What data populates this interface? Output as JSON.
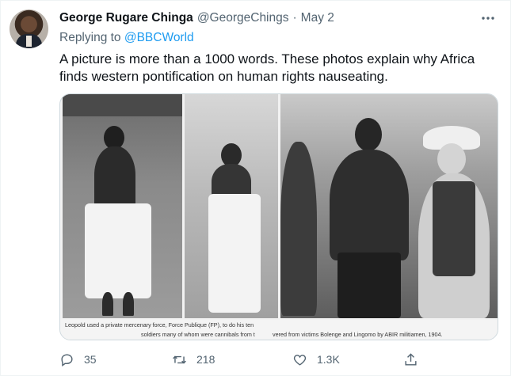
{
  "tweet": {
    "author_name": "George Rugare Chinga",
    "author_handle": "@GeorgeChings",
    "separator": "·",
    "date": "May 2",
    "replying_prefix": "Replying to",
    "replying_mention": "@BBCWorld",
    "text": "A picture is more than a 1000 words. These photos explain why Africa finds western pontification on human rights nauseating.",
    "more_icon": "more-horizontal-icon"
  },
  "media": {
    "caption_line1": "Leopold used a private mercenary force, Force Publique (FP), to do his ten",
    "caption_line2_left": "soldiers many of whom were cannibals from t",
    "caption_line2_right": "vered from victims Bolenge and Lingomo by ABIR militiamen, 1904."
  },
  "actions": {
    "reply_count": "35",
    "retweet_count": "218",
    "like_count": "1.3K",
    "icons": [
      "reply-icon",
      "retweet-icon",
      "like-icon",
      "share-icon"
    ]
  }
}
